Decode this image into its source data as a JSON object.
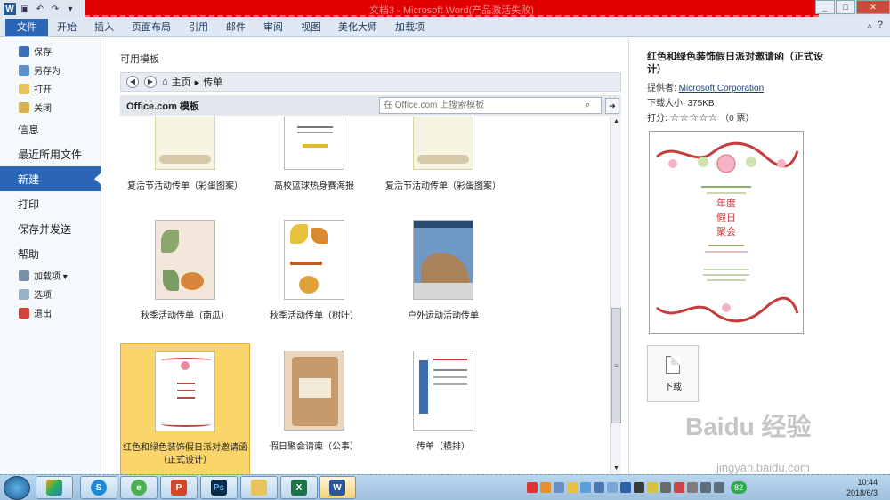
{
  "window": {
    "title": "文档3 - Microsoft Word(产品激活失败)"
  },
  "ribbon_tabs": [
    "文件",
    "开始",
    "插入",
    "页面布局",
    "引用",
    "邮件",
    "审阅",
    "视图",
    "美化大师",
    "加载项"
  ],
  "backstage_menu": {
    "small_top": [
      "保存",
      "另存为",
      "打开",
      "关闭"
    ],
    "big": [
      "信息",
      "最近所用文件",
      "新建",
      "打印",
      "保存并发送",
      "帮助"
    ],
    "small_bottom": [
      "加载项 ▾",
      "选项",
      "退出"
    ],
    "active": "新建"
  },
  "templates": {
    "section_title": "可用模板",
    "breadcrumb": {
      "home": "主页",
      "current": "传单"
    },
    "source_label": "Office.com 模板",
    "search_placeholder": "在 Office.com 上搜索模板",
    "items": [
      {
        "label": "复活节活动传单（彩蛋图案）"
      },
      {
        "label": "高校篮球热身赛海报"
      },
      {
        "label": "复活节活动传单（彩蛋图案）"
      },
      {
        "label": "秋季活动传单（南瓜）"
      },
      {
        "label": "秋季活动传单（树叶）"
      },
      {
        "label": "户外运动活动传单"
      },
      {
        "label": "红色和绿色装饰假日派对邀请函（正式设计）"
      },
      {
        "label": "假日聚会请柬（公事）"
      },
      {
        "label": "传单（横排）"
      }
    ]
  },
  "detail": {
    "title": "红色和绿色装饰假日派对邀请函（正式设计）",
    "provider_label": "提供者:",
    "provider": "Microsoft Corporation",
    "size": "下载大小: 375KB",
    "rating_label": "打分:",
    "stars": "☆☆☆☆☆",
    "votes": "（0 票）",
    "preview_lines": [
      "年度",
      "假日",
      "聚会"
    ],
    "download_label": "下载"
  },
  "taskbar": {
    "time": "10:44",
    "date": "2018/6/3",
    "badge": "82"
  },
  "watermark": {
    "logo": "Baidu 经验",
    "url": "jingyan.baidu.com"
  },
  "colors": {
    "file_tab": "#2a65b6",
    "selected_tile": "#fcd56a",
    "titlebar_overlay": "#e00000"
  }
}
